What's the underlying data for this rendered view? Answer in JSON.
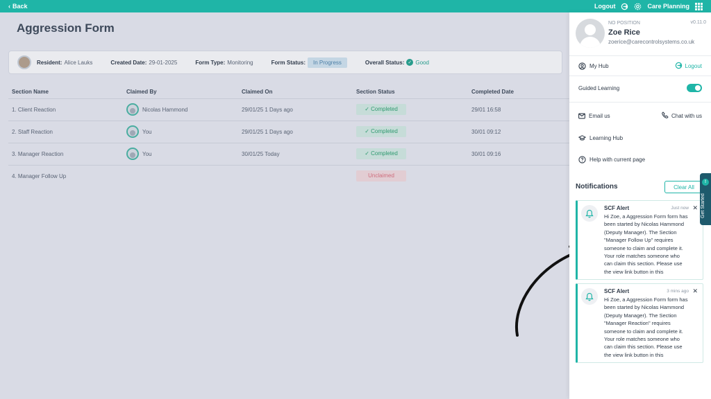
{
  "topbar": {
    "back_label": "Back",
    "logout_label": "Logout",
    "app_label": "Care Planning",
    "brand_color": "#1fb5a7"
  },
  "page": {
    "title": "Aggression Form"
  },
  "info": {
    "resident_label": "Resident:",
    "resident_value": "Alice Lauks",
    "created_label": "Created Date:",
    "created_value": "29-01-2025",
    "type_label": "Form Type:",
    "type_value": "Monitoring",
    "status_label": "Form Status:",
    "status_value": "In Progress",
    "overall_label": "Overall Status:",
    "overall_value": "Good"
  },
  "table": {
    "headers": [
      "Section Name",
      "Claimed By",
      "Claimed On",
      "Section Status",
      "Completed Date"
    ],
    "rows": [
      {
        "section": "1. Client Reaction",
        "claimed_by": "Nicolas Hammond",
        "claimed_on": "29/01/25 1 Days ago",
        "status": "Completed",
        "completed": "29/01 16:58"
      },
      {
        "section": "2. Staff Reaction",
        "claimed_by": "You",
        "claimed_on": "29/01/25 1 Days ago",
        "status": "Completed",
        "completed": "30/01 09:12"
      },
      {
        "section": "3. Manager Reaction",
        "claimed_by": "You",
        "claimed_on": "30/01/25 Today",
        "status": "Completed",
        "completed": "30/01 09:16"
      },
      {
        "section": "4. Manager Follow Up",
        "claimed_by": "",
        "claimed_on": "",
        "status": "Unclaimed",
        "completed": ""
      }
    ]
  },
  "panel": {
    "position": "NO POSITION",
    "version": "v0.11.0",
    "name": "Zoe Rice",
    "email": "zoerice@carecontrolsystems.co.uk",
    "my_hub": "My Hub",
    "logout": "Logout",
    "guided_learning": "Guided Learning",
    "guided_learning_on": true,
    "email_us": "Email us",
    "chat_with_us": "Chat with us",
    "learning_hub": "Learning Hub",
    "help_page": "Help with current page",
    "notifications_title": "Notifications",
    "clear_all": "Clear All",
    "notifications": [
      {
        "title": "SCF Alert",
        "time": "Just now",
        "lines": [
          "Hi Zoe, a Aggression Form form has",
          "been started by Nicolas Hammond",
          "(Deputy Manager). The Section",
          "\"Manager Follow Up\" requires",
          "someone to claim and complete it.",
          "Your role matches someone who",
          "can claim this section. Please use",
          "the view link button in this"
        ]
      },
      {
        "title": "SCF Alert",
        "time": "3 mins ago",
        "lines": [
          "Hi Zoe, a Aggression Form form has",
          "been started by Nicolas Hammond",
          "(Deputy Manager). The Section",
          "\"Manager Reaction\" requires",
          "someone to claim and complete it.",
          "Your role matches someone who",
          "can claim this section. Please use",
          "the view link button in this"
        ]
      }
    ],
    "get_started": "Get Started"
  }
}
